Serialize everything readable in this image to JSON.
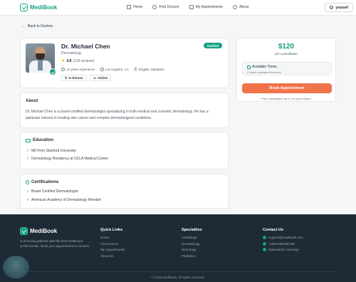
{
  "brand": {
    "name": "MediBook"
  },
  "nav": [
    {
      "label": "Home"
    },
    {
      "label": "Find Doctors"
    },
    {
      "label": "My Appointments"
    },
    {
      "label": "About"
    }
  ],
  "user": {
    "name": "yousef"
  },
  "back_label": "Back to Doctors",
  "doctor": {
    "name": "Dr. Michael Chen",
    "specialty": "Dermatology",
    "badge": "Verified",
    "rating": "4.8",
    "reviews": "(139 reviews)",
    "experience": "12 years experience",
    "location": "Los Angeles, CA",
    "languages": "English, Mandarin",
    "modes": [
      "In Person",
      "Online"
    ]
  },
  "booking": {
    "price": "$120",
    "per": "per consultation",
    "avail_title": "Available Times",
    "avail_sub": "2 dates available this week",
    "button": "Book Appointment",
    "note": "Free cancellation up to 24 hours before"
  },
  "about": {
    "title": "About",
    "text": "Dr. Michael Chen is a board-certified dermatologist specializing in both medical and cosmetic dermatology. He has a particular interest in treating skin cancer and complex dermatological conditions."
  },
  "education": {
    "title": "Education",
    "items": [
      "MD from Stanford University",
      "Dermatology Residency at UCLA Medical Center"
    ]
  },
  "certifications": {
    "title": "Certifications",
    "items": [
      "Board Certified Dermatologist",
      "American Academy of Dermatology Member"
    ]
  },
  "footer": {
    "description": "Connecting patients with the best healthcare professionals. Book your appointment in minutes.",
    "quick_links": {
      "title": "Quick Links",
      "items": [
        "Home",
        "Find Doctors",
        "My Appointments",
        "About Us"
      ]
    },
    "specialties": {
      "title": "Specialties",
      "items": [
        "Cardiology",
        "Dermatology",
        "Neurology",
        "Pediatrics"
      ]
    },
    "contact": {
      "title": "Contact Us",
      "items": [
        "support@medibook.com",
        "1-800-MEDIBOOK",
        "Nationwide Coverage"
      ]
    },
    "copyright": "© 2026 MediBook. All rights reserved."
  },
  "colors": {
    "accent": "#16a085",
    "cta": "#f0734a",
    "footer_bg": "#1e2a36"
  }
}
